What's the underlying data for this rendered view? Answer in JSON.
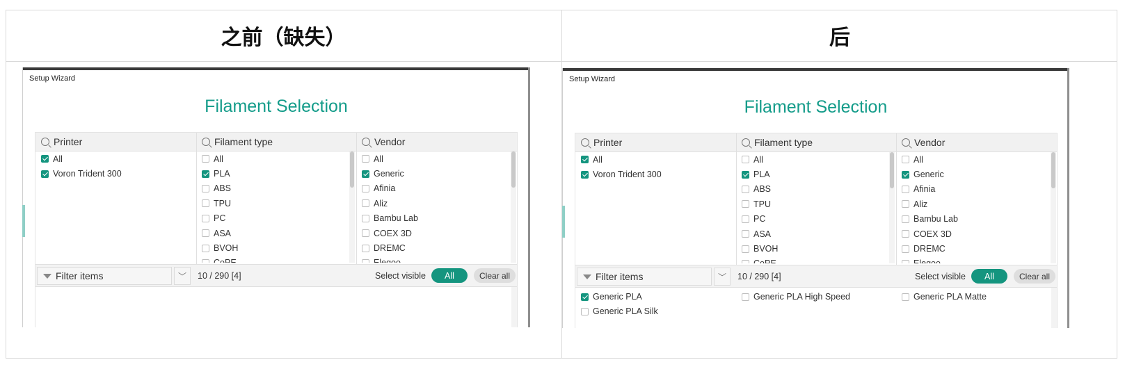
{
  "header": {
    "before": "之前（缺失）",
    "after": "后"
  },
  "window": {
    "title": "Setup Wizard",
    "heading": "Filament Selection"
  },
  "columns": {
    "printer": "Printer",
    "filament": "Filament type",
    "vendor": "Vendor"
  },
  "printers": [
    {
      "label": "All",
      "checked": true
    },
    {
      "label": "Voron Trident 300",
      "checked": true
    }
  ],
  "filaments": [
    {
      "label": "All",
      "checked": false
    },
    {
      "label": "PLA",
      "checked": true
    },
    {
      "label": "ABS",
      "checked": false
    },
    {
      "label": "TPU",
      "checked": false
    },
    {
      "label": "PC",
      "checked": false
    },
    {
      "label": "ASA",
      "checked": false
    },
    {
      "label": "BVOH",
      "checked": false
    },
    {
      "label": "CoPE",
      "checked": false
    }
  ],
  "vendors": [
    {
      "label": "All",
      "checked": false
    },
    {
      "label": "Generic",
      "checked": true
    },
    {
      "label": "Afinia",
      "checked": false
    },
    {
      "label": "Aliz",
      "checked": false
    },
    {
      "label": "Bambu Lab",
      "checked": false
    },
    {
      "label": "COEX 3D",
      "checked": false
    },
    {
      "label": "DREMC",
      "checked": false
    },
    {
      "label": "Elegoo",
      "checked": false
    }
  ],
  "filter": {
    "placeholder": "Filter items",
    "count": "10 / 290 [4]",
    "select_visible": "Select visible",
    "all_btn": "All",
    "clear_btn": "Clear all"
  },
  "results_before": [],
  "results_after": [
    {
      "label": "Generic PLA",
      "checked": true
    },
    {
      "label": "Generic PLA High Speed",
      "checked": false
    },
    {
      "label": "Generic PLA Matte",
      "checked": false
    },
    {
      "label": "Generic PLA Silk",
      "checked": false
    }
  ],
  "colors": {
    "accent": "#14957f",
    "title": "#149c8a"
  }
}
